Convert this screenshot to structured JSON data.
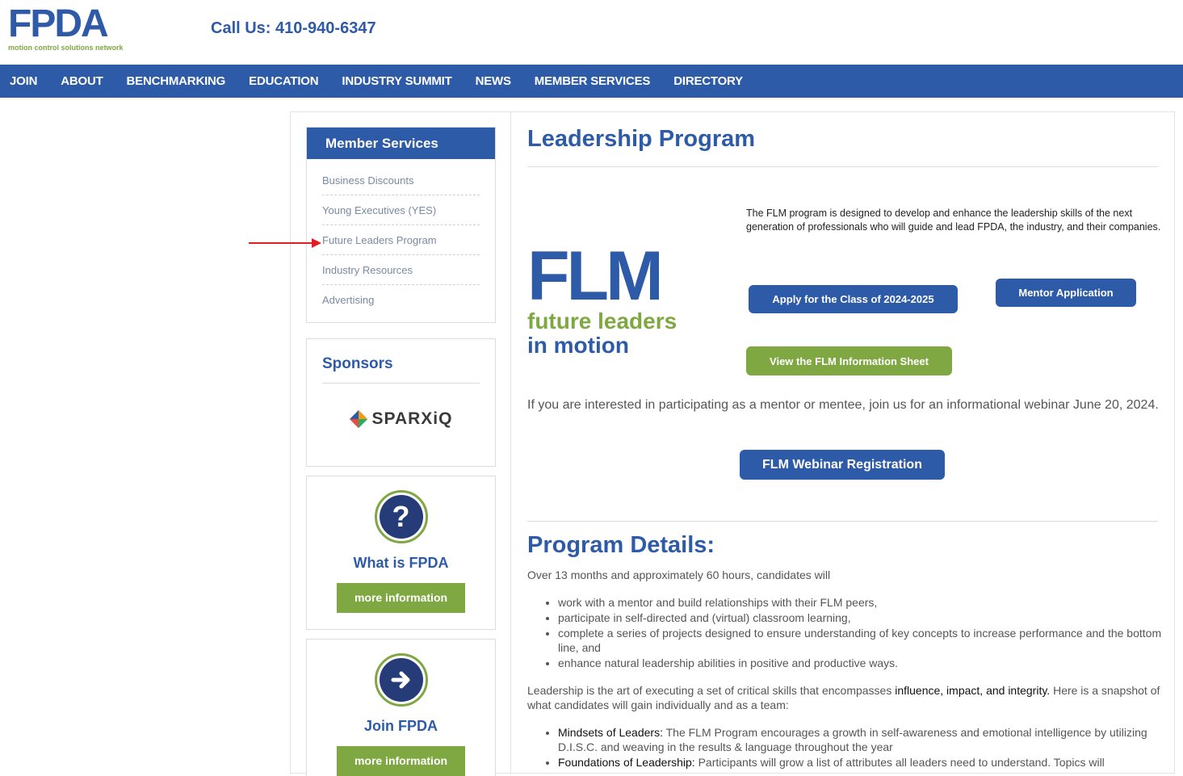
{
  "header": {
    "logo_text": "FPDA",
    "logo_tagline": "motion control solutions network",
    "call": "Call Us: 410-940-6347"
  },
  "nav": [
    "JOIN",
    "ABOUT",
    "BENCHMARKING",
    "EDUCATION",
    "INDUSTRY SUMMIT",
    "NEWS",
    "MEMBER SERVICES",
    "DIRECTORY"
  ],
  "sidebar": {
    "member_services": {
      "title": "Member Services",
      "items": [
        "Business Discounts",
        "Young Executives (YES)",
        "Future Leaders Program",
        "Industry Resources",
        "Advertising"
      ]
    },
    "sponsors": {
      "title": "Sponsors",
      "logo_text": "SPARXiQ"
    },
    "what_is": {
      "title": "What is FPDA",
      "button": "more information"
    },
    "join": {
      "title": "Join FPDA",
      "button": "more information"
    }
  },
  "main": {
    "title": "Leadership Program",
    "flm_logo": {
      "big": "FLM",
      "line1": "future leaders",
      "line2": "in motion"
    },
    "intro": "The FLM program is designed to develop and enhance the leadership skills of the next generation of professionals who will guide and lead FPDA, the industry, and their companies.",
    "buttons": {
      "apply": "Apply for the Class of 2024-2025",
      "mentor": "Mentor Application",
      "info_sheet": "View the FLM Information Sheet",
      "webinar": "FLM Webinar Registration"
    },
    "webinar_text": "If you are interested in participating as a mentor or mentee, join us for an informational webinar June 20, 2024.",
    "details_title": "Program Details:",
    "details_intro": "Over 13 months and approximately 60 hours, candidates will",
    "details_list": [
      "work with a mentor and build relationships with their FLM peers,",
      "participate in self-directed and (virtual) classroom learning,",
      "complete a series of projects designed to ensure understanding of key concepts to increase performance and the bottom line, and",
      "enhance natural leadership abilities in positive and productive ways."
    ],
    "leadership_p1": "Leadership is the art of executing a set of critical skills that encompasses ",
    "leadership_strong": "influence, impact, and integrity.",
    "leadership_p2": " Here is a snapshot of what candidates will gain individually and as a team:",
    "topics": [
      {
        "label": "Mindsets of Leaders:",
        "text": " The FLM Program encourages a growth in self-awareness and emotional intelligence by utilizing D.I.S.C. and weaving in the results & language throughout the year"
      },
      {
        "label": "Foundations of Leadership:",
        "text": " Participants will grow a list of attributes all leaders need to understand. Topics will"
      }
    ]
  },
  "colors": {
    "brand_blue": "#2e5ba8",
    "brand_green": "#7fa842",
    "annotation_arrow": "#e02020"
  }
}
